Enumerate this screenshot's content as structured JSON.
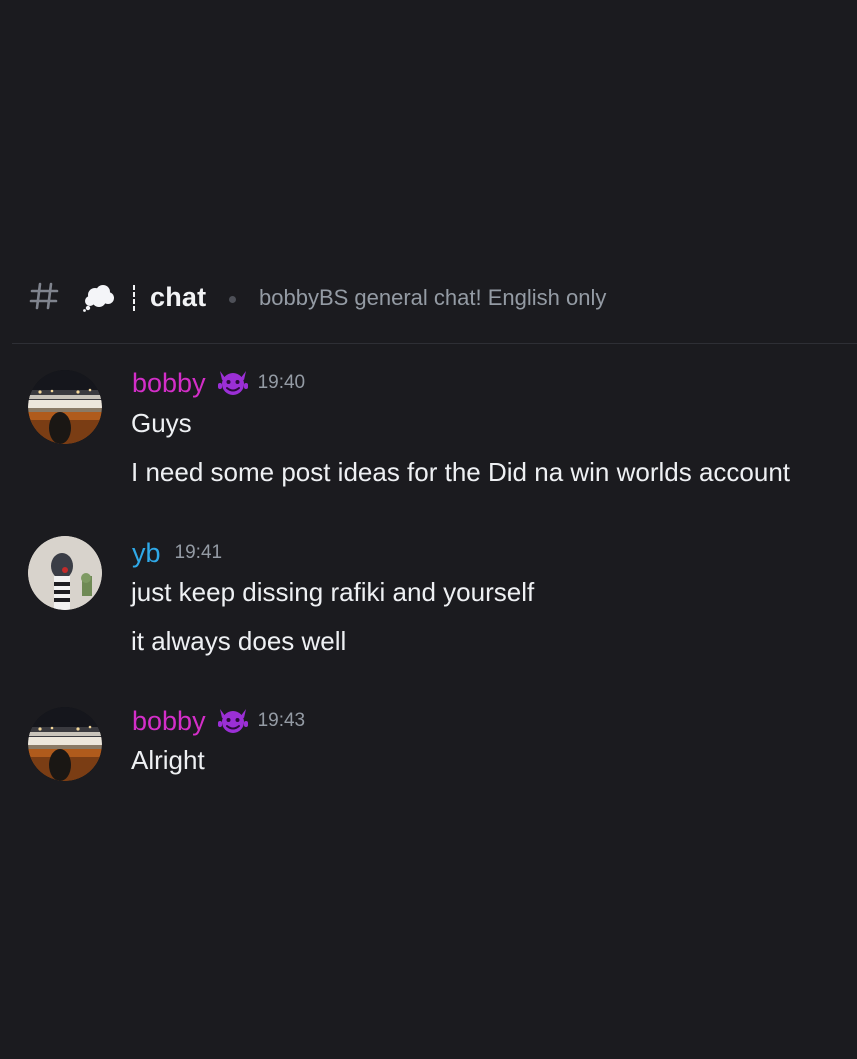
{
  "channel": {
    "name": "chat",
    "topic": "bobbyBS general chat! English only",
    "prefix_icons": [
      "hashtag-icon",
      "thought-balloon-icon"
    ]
  },
  "colors": {
    "bobby": "#d32ec8",
    "yb": "#2fa9e8",
    "background": "#1b1b1f",
    "text": "#eef0f3",
    "muted": "#949ba4"
  },
  "messages": [
    {
      "author": "bobby",
      "badge": "purple-devil-icon",
      "time": "19:40",
      "lines": [
        "Guys",
        "I need some post ideas for the Did na win worlds account"
      ]
    },
    {
      "author": "yb",
      "badge": "",
      "time": "19:41",
      "lines": [
        "just keep dissing rafiki and yourself",
        "it always does well"
      ]
    },
    {
      "author": "bobby",
      "badge": "purple-devil-icon",
      "time": "19:43",
      "lines": [
        "Alright"
      ]
    }
  ]
}
